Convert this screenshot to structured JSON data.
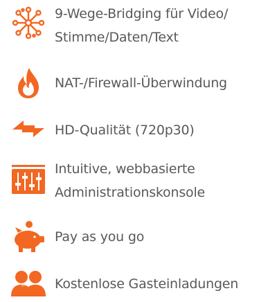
{
  "colors": {
    "accent": "#f26722",
    "text": "#58595b"
  },
  "features": [
    {
      "icon": "network-bridge-icon",
      "line1": "9-Wege-Bridging für Video/",
      "line2": "Stimme/Daten/Text"
    },
    {
      "icon": "flame-icon",
      "line1": "NAT-/Firewall-Überwindung"
    },
    {
      "icon": "double-arrow-icon",
      "line1": "HD-Qualität (720p30)"
    },
    {
      "icon": "control-panel-icon",
      "line1": "Intuitive, webbasierte",
      "line2": "Administrationskonsole"
    },
    {
      "icon": "piggy-bank-icon",
      "line1": "Pay as you go"
    },
    {
      "icon": "guests-icon",
      "line1": "Kostenlose Gasteinladungen"
    }
  ]
}
